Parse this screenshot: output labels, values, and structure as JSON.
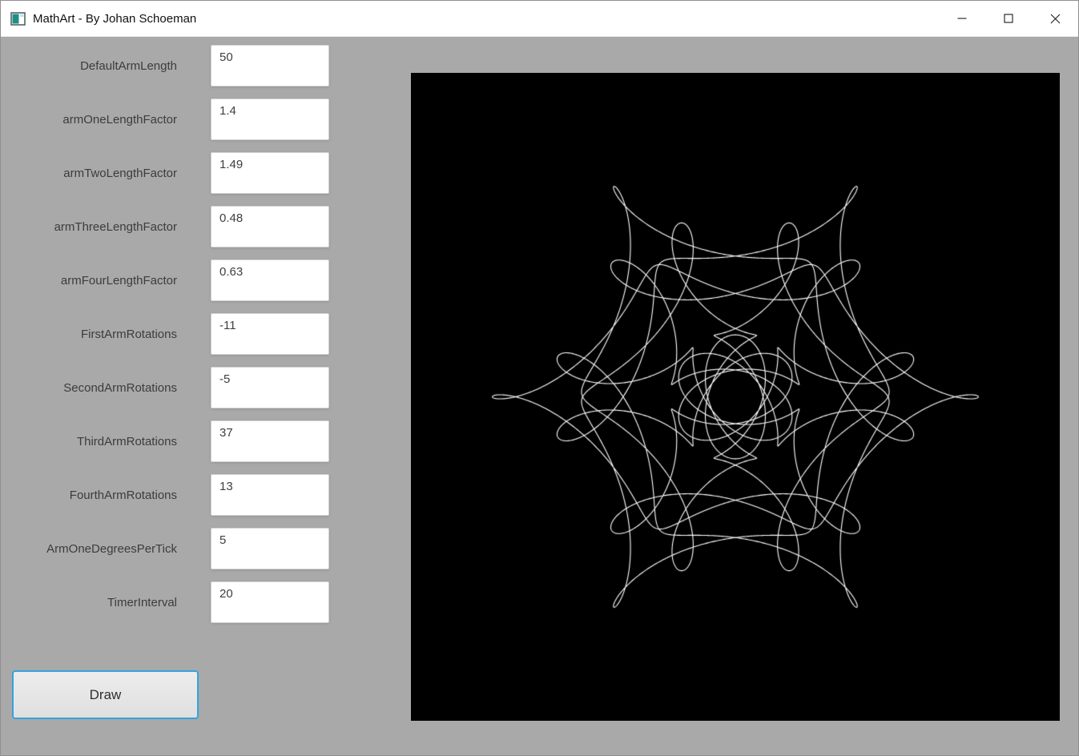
{
  "window": {
    "title": "MathArt - By Johan Schoeman",
    "controls": {
      "minimize": "minimize",
      "maximize": "maximize",
      "close": "close"
    }
  },
  "fields": [
    {
      "label": "DefaultArmLength",
      "value": "50"
    },
    {
      "label": "armOneLengthFactor",
      "value": "1.4"
    },
    {
      "label": "armTwoLengthFactor",
      "value": "1.49"
    },
    {
      "label": "armThreeLengthFactor",
      "value": "0.48"
    },
    {
      "label": "armFourLengthFactor",
      "value": "0.63"
    },
    {
      "label": "FirstArmRotations",
      "value": "-11"
    },
    {
      "label": "SecondArmRotations",
      "value": "-5"
    },
    {
      "label": "ThirdArmRotations",
      "value": "37"
    },
    {
      "label": "FourthArmRotations",
      "value": "13"
    },
    {
      "label": "ArmOneDegreesPerTick",
      "value": "5"
    },
    {
      "label": "TimerInterval",
      "value": "20"
    }
  ],
  "draw_button": {
    "label": "Draw"
  },
  "canvas": {
    "background": "#000000",
    "stroke": "#ffffff"
  },
  "colors": {
    "window_background": "#a9a9a9",
    "titlebar_background": "#ffffff",
    "button_border": "#35a3dc",
    "label_text": "#3c3c3c"
  }
}
